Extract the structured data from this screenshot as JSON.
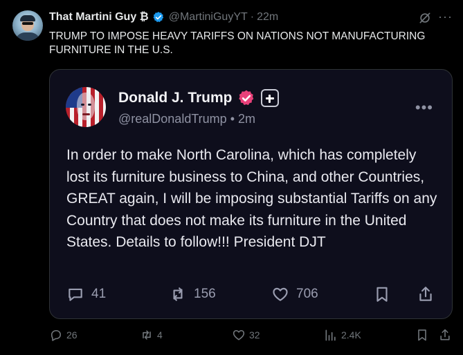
{
  "post": {
    "display_name": "That Martini Guy ₿",
    "handle": "@MartiniGuyYT",
    "separator": "·",
    "time": "22m",
    "text": "TRUMP TO IMPOSE HEAVY TARIFFS ON NATIONS NOT MANUFACTURING FURNITURE IN THE U.S.",
    "more": "···",
    "stats": {
      "replies": "26",
      "reposts": "4",
      "likes": "32",
      "views": "2.4K"
    }
  },
  "quoted": {
    "display_name": "Donald J. Trump",
    "handle": "@realDonaldTrump",
    "separator": "•",
    "time": "2m",
    "more": "•••",
    "text": "In order to make North Carolina, which has completely lost its furniture business to China, and other Countries, GREAT again, I will be imposing substantial Tariffs on any Country that does not make its furniture in the United States. Details to follow!!! President DJT",
    "stats": {
      "replies": "41",
      "reposts": "156",
      "likes": "706"
    }
  },
  "colors": {
    "background": "#000000",
    "quote_background": "#0e0e1c",
    "verified_blue": "#1d9bf0",
    "verified_pink": "#e8417a",
    "muted": "#71767b"
  },
  "icons": [
    "verified-badge-icon",
    "grok-icon",
    "more-icon",
    "reply-icon",
    "repost-icon",
    "like-icon",
    "views-icon",
    "bookmark-icon",
    "share-icon",
    "truth-plus-icon"
  ]
}
